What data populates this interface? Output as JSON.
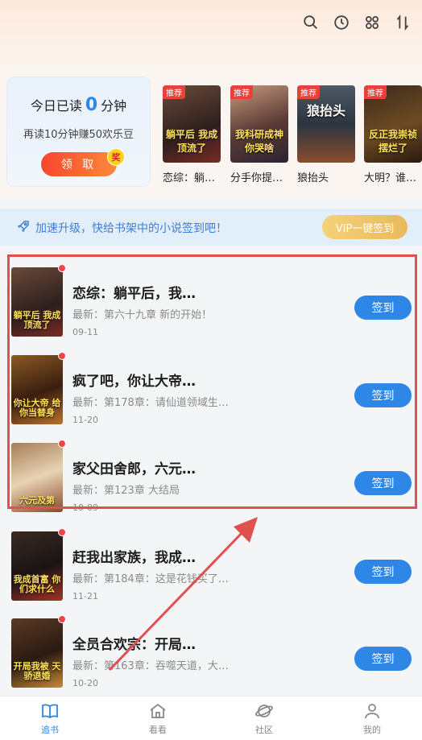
{
  "top_icons": [
    "search-icon",
    "history-icon",
    "grid-icon",
    "sort-icon"
  ],
  "read_card": {
    "title_prefix": "今日已读",
    "minutes": "0",
    "title_suffix": "分钟",
    "subtitle": "再读10分钟赚50欢乐豆",
    "collect_label": "领 取",
    "badge": "奖"
  },
  "recommend": [
    {
      "tag": "推荐",
      "cover_text": "躺平后 我成顶流了",
      "title": "恋综：躺…"
    },
    {
      "tag": "推荐",
      "cover_text": "我科研成神 你哭啥",
      "title": "分手你提…"
    },
    {
      "tag": "推荐",
      "cover_text": "狼抬头",
      "title": "狼抬头"
    },
    {
      "tag": "推荐",
      "cover_text": "反正我崇祯 摆烂了",
      "title": "大明？谁…"
    }
  ],
  "banner": {
    "text": "加速升级，快给书架中的小说签到吧！",
    "vip_label": "VIP一键签到"
  },
  "books": [
    {
      "title": "恋综：躺平后，我…",
      "latest": "最新：第六十九章 新的开始！",
      "date": "09-11",
      "sign": "签到",
      "cover_text": "躺平后 我成顶流了"
    },
    {
      "title": "疯了吧，你让大帝…",
      "latest": "最新：第178章：请仙道领域生…",
      "date": "11-20",
      "sign": "签到",
      "cover_text": "你让大帝 给你当替身"
    },
    {
      "title": "家父田舍郎，六元…",
      "latest": "最新：第123章 大结局",
      "date": "10-09",
      "sign": "签到",
      "cover_text": "六元及第"
    },
    {
      "title": "赶我出家族，我成…",
      "latest": "最新：第184章：这是花钱买了…",
      "date": "11-21",
      "sign": "签到",
      "cover_text": "我成首富 你们求什么"
    },
    {
      "title": "全员合欢宗：开局…",
      "latest": "最新：第163章：吞噬天道，大…",
      "date": "10-20",
      "sign": "签到",
      "cover_text": "开局我被 天骄退婚"
    }
  ],
  "tabs": [
    {
      "label": "追书",
      "icon": "book-icon"
    },
    {
      "label": "看看",
      "icon": "home-icon"
    },
    {
      "label": "社区",
      "icon": "planet-icon"
    },
    {
      "label": "我的",
      "icon": "user-icon"
    }
  ],
  "colors": {
    "accent": "#2e86e6",
    "annotation": "#e0504f"
  }
}
